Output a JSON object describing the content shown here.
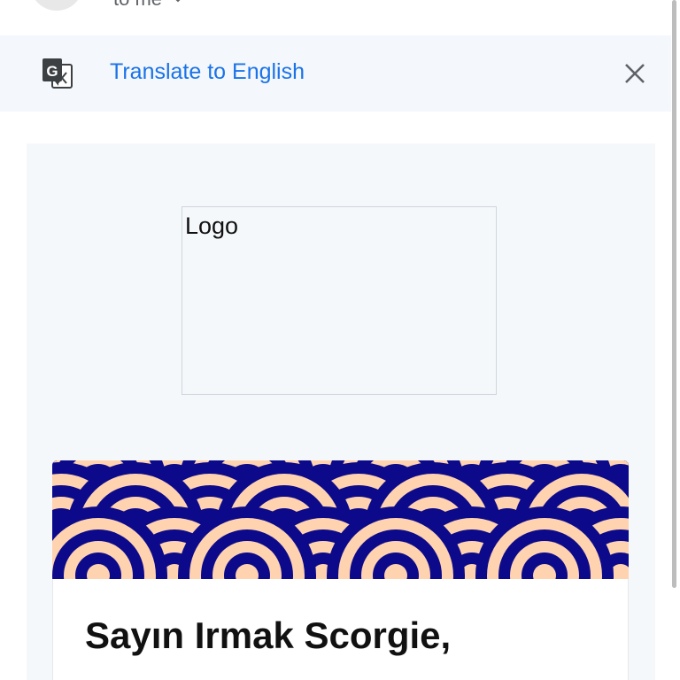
{
  "header": {
    "recipient": "to me",
    "icons": {
      "avatar": "avatar",
      "chevron": "chevron-down-icon"
    }
  },
  "translate_bar": {
    "link_label": "Translate to English",
    "icons": {
      "translate": "google-translate-icon",
      "close": "close-icon"
    },
    "colors": {
      "link": "#1a73e8",
      "background": "#f4f7fb"
    }
  },
  "email": {
    "logo_placeholder": "Logo",
    "greeting": "Sayın Irmak Scorgie,",
    "banner": {
      "colors": {
        "primary": "#0c0a8a",
        "secondary": "#ffd2b0"
      }
    }
  }
}
